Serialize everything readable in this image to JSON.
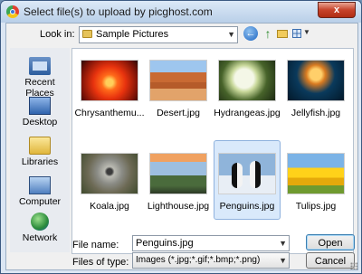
{
  "window": {
    "title": "Select file(s) to upload by picghost.com",
    "close_label": "x"
  },
  "toolbar": {
    "look_in_label": "Look in:",
    "look_in_value": "Sample Pictures",
    "back_glyph": "←",
    "up_glyph": "↑"
  },
  "places": [
    {
      "label": "Recent Places",
      "icon": "recent-places-icon"
    },
    {
      "label": "Desktop",
      "icon": "desktop-icon"
    },
    {
      "label": "Libraries",
      "icon": "libraries-icon"
    },
    {
      "label": "Computer",
      "icon": "computer-icon"
    },
    {
      "label": "Network",
      "icon": "network-icon"
    }
  ],
  "files": [
    {
      "name": "Chrysanthemu...",
      "thumb": "chrysanthemum"
    },
    {
      "name": "Desert.jpg",
      "thumb": "desert"
    },
    {
      "name": "Hydrangeas.jpg",
      "thumb": "hydrangeas"
    },
    {
      "name": "Jellyfish.jpg",
      "thumb": "jellyfish"
    },
    {
      "name": "Koala.jpg",
      "thumb": "koala"
    },
    {
      "name": "Lighthouse.jpg",
      "thumb": "lighthouse"
    },
    {
      "name": "Penguins.jpg",
      "thumb": "penguins",
      "selected": true
    },
    {
      "name": "Tulips.jpg",
      "thumb": "tulips"
    }
  ],
  "footer": {
    "file_name_label": "File name:",
    "file_name_value": "Penguins.jpg",
    "file_type_label": "Files of type:",
    "file_type_value": "Images (*.jpg;*.gif;*.bmp;*.png)",
    "open_label": "Open",
    "cancel_label": "Cancel"
  }
}
